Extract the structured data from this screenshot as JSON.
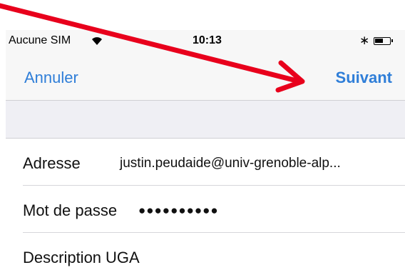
{
  "status_bar": {
    "carrier": "Aucune SIM",
    "time": "10:13",
    "battery_level": 0.6
  },
  "nav": {
    "cancel_label": "Annuler",
    "next_label": "Suivant"
  },
  "form": {
    "address_label": "Adresse",
    "address_value": "justin.peudaide@univ-grenoble-alp...",
    "password_label": "Mot de passe",
    "password_value": "●●●●●●●●●●",
    "description_label": "Description",
    "description_value": "UGA"
  },
  "colors": {
    "accent": "#2f7ed8",
    "annotation": "#e8001c"
  }
}
